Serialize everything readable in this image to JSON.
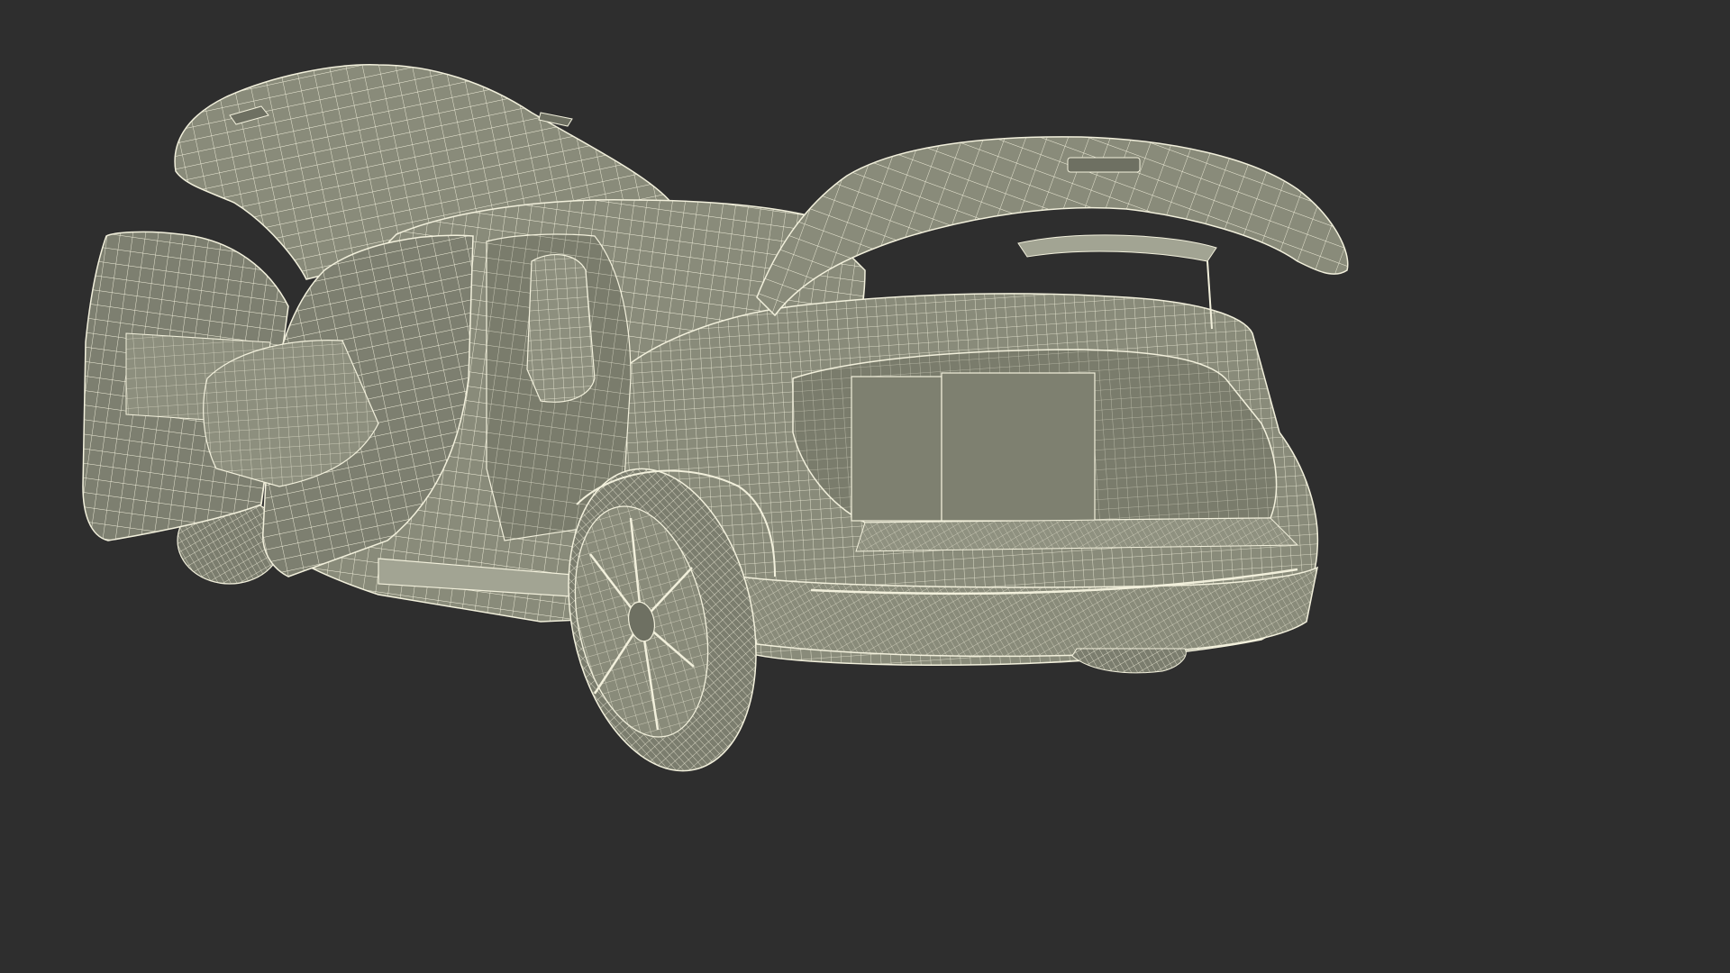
{
  "scene": {
    "subject": "3d-wireframe-car-open-doors-hood-trunk",
    "colors": {
      "background": "#2e2e2e",
      "shell": "#898b7a",
      "shell_dark": "#6e7062",
      "shell_light": "#a2a493",
      "interior": "#7d7f70",
      "wire": "#f2f0dc",
      "tire": "#7b7d6e",
      "trunk_cavity": "#7a7c6c"
    }
  }
}
